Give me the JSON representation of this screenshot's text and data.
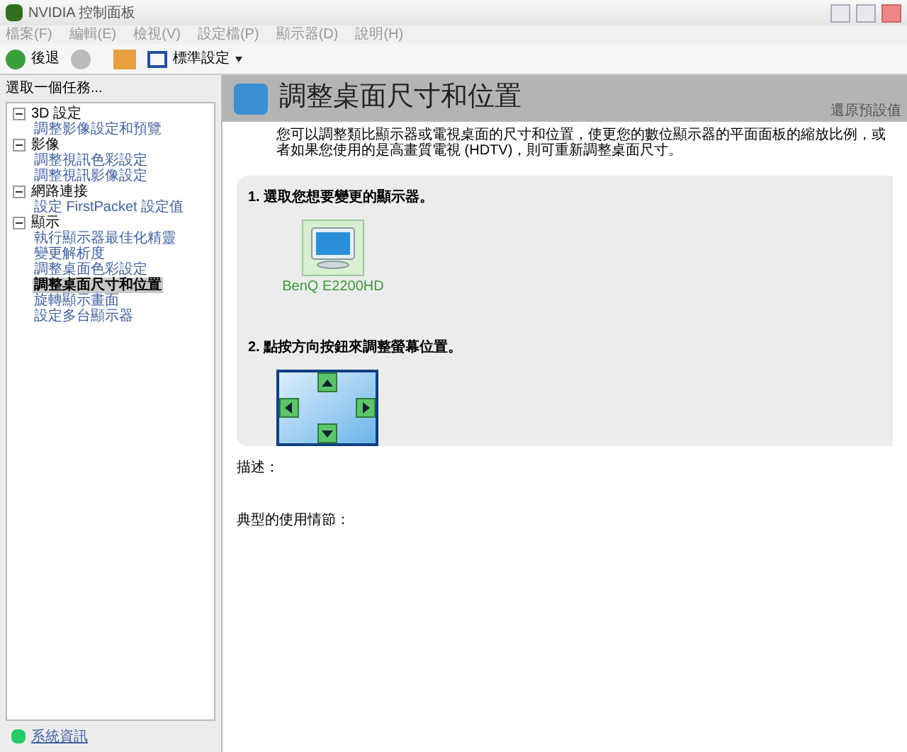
{
  "window": {
    "title": "NVIDIA 控制面板"
  },
  "menu": [
    "檔案(F)",
    "編輯(E)",
    "檢視(V)",
    "設定檔(P)",
    "顯示器(D)",
    "說明(H)"
  ],
  "toolbar": {
    "back": "後退",
    "view": "標準設定"
  },
  "sidebar": {
    "heading": "選取一個任務...",
    "tree": [
      {
        "label": "3D 設定",
        "expanded": true,
        "children": [
          {
            "label": "調整影像設定和預覽",
            "selected": false
          }
        ]
      },
      {
        "label": "影像",
        "expanded": true,
        "children": [
          {
            "label": "調整視訊色彩設定",
            "selected": false
          },
          {
            "label": "調整視訊影像設定",
            "selected": false
          }
        ]
      },
      {
        "label": "網路連接",
        "expanded": true,
        "children": [
          {
            "label": "設定 FirstPacket 設定值",
            "selected": false
          }
        ]
      },
      {
        "label": "顯示",
        "expanded": true,
        "children": [
          {
            "label": "執行顯示器最佳化精靈",
            "selected": false
          },
          {
            "label": "變更解析度",
            "selected": false
          },
          {
            "label": "調整桌面色彩設定",
            "selected": false
          },
          {
            "label": "調整桌面尺寸和位置",
            "selected": true
          },
          {
            "label": "旋轉顯示畫面",
            "selected": false
          },
          {
            "label": "設定多台顯示器",
            "selected": false
          }
        ]
      }
    ],
    "footer_link": "系統資訊"
  },
  "page": {
    "title": "調整桌面尺寸和位置",
    "restore": "還原預設值",
    "description": "您可以調整類比顯示器或電視桌面的尺寸和位置，使更您的數位顯示器的平面面板的縮放比例，或者如果您使用的是高畫質電視 (HDTV)，則可重新調整桌面尺寸。",
    "step1": "1. 選取您想要變更的顯示器。",
    "display": {
      "name": "BenQ E2200HD",
      "selected": true
    },
    "step2": "2. 點按方向按鈕來調整螢幕位置。",
    "desc_label": "描述：",
    "usage_label": "典型的使用情節："
  }
}
